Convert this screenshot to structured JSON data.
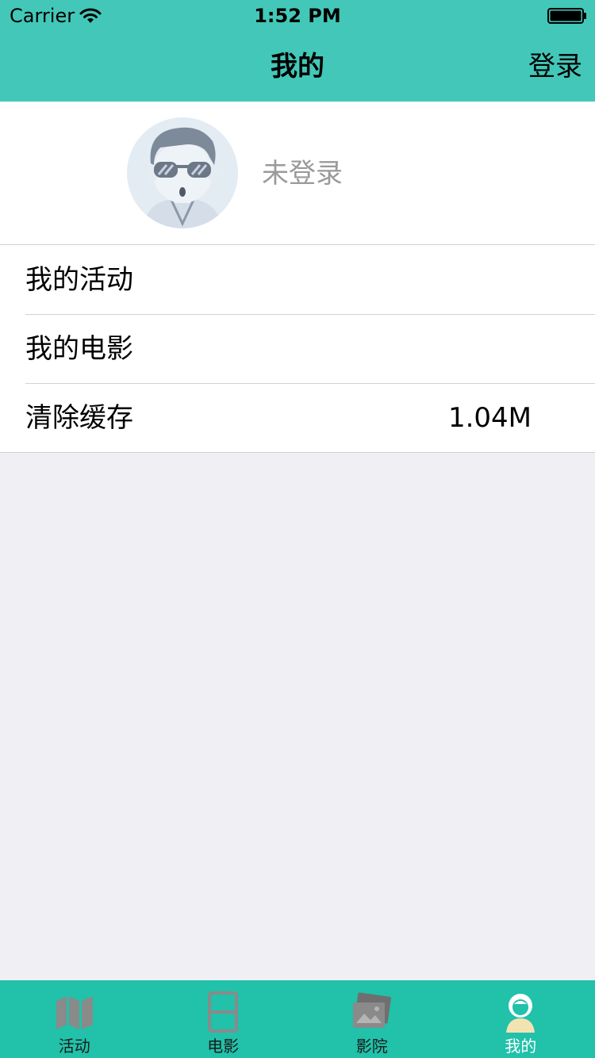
{
  "status_bar": {
    "carrier": "Carrier",
    "time": "1:52 PM"
  },
  "nav": {
    "title": "我的",
    "login_button": "登录"
  },
  "profile": {
    "status": "未登录"
  },
  "menu": {
    "items": [
      {
        "label": "我的活动"
      },
      {
        "label": "我的电影"
      },
      {
        "label": "清除缓存",
        "value": "1.04M"
      }
    ]
  },
  "tab_bar": {
    "tabs": [
      {
        "label": "活动",
        "icon": "map-icon"
      },
      {
        "label": "电影",
        "icon": "film-icon"
      },
      {
        "label": "影院",
        "icon": "theater-icon"
      },
      {
        "label": "我的",
        "icon": "user-icon",
        "active": true
      }
    ]
  },
  "colors": {
    "header": "#43c7b8",
    "tab_bar": "#21c1aa",
    "page_background": "#efeff4"
  }
}
